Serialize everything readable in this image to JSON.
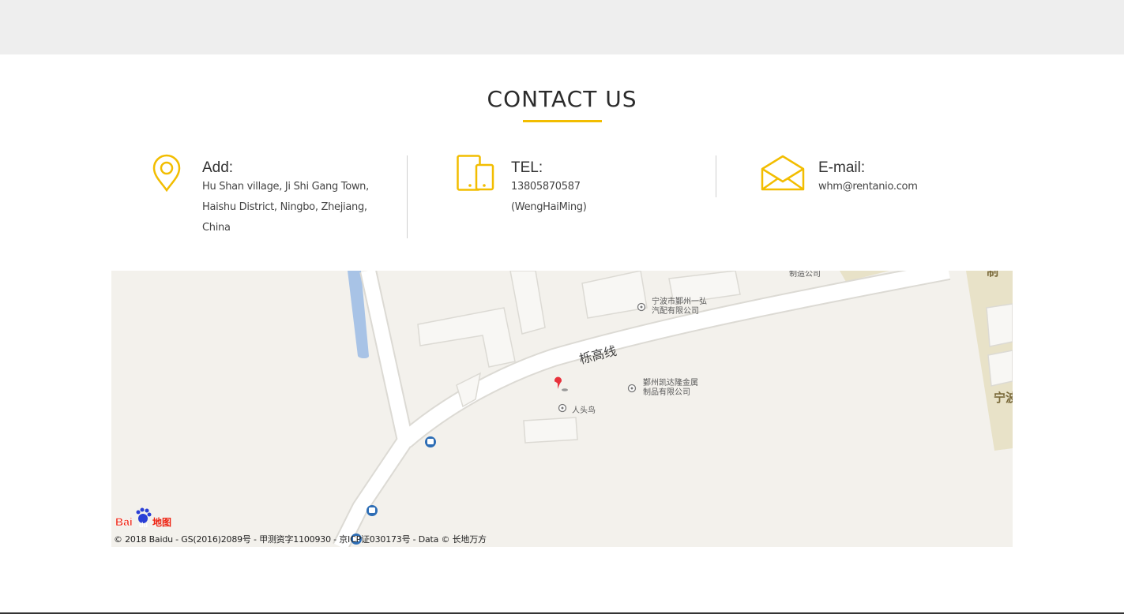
{
  "section": {
    "title": "CONTACT US"
  },
  "contacts": [
    {
      "icon": "location-pin-icon",
      "heading": "Add:",
      "lines": [
        "Hu Shan village, Ji Shi Gang Town,",
        "Haishu District, Ningbo, Zhejiang,",
        "China"
      ]
    },
    {
      "icon": "mobile-phone-icon",
      "heading": "TEL:",
      "lines": [
        "13805870587 (WengHaiMing)"
      ]
    },
    {
      "icon": "envelope-icon",
      "heading": "E-mail:",
      "lines": [
        "whm@rentanio.com"
      ]
    }
  ],
  "colors": {
    "accent": "#f2bd00",
    "marker": "#e8323c",
    "bus_stop": "#2d6db5",
    "map_bg": "#f3f1ec",
    "water": "#a8c3e6"
  },
  "map": {
    "road_name": "栎高线",
    "pois": [
      {
        "name_line1": "宁波市鄞州一弘",
        "name_line2": "汽配有限公司"
      },
      {
        "name_line1": "鄞州凯达隆金属",
        "name_line2": "制品有限公司"
      },
      {
        "name_line1": "人头鸟",
        "name_line2": ""
      },
      {
        "name_line1": "制造公司",
        "name_line2": ""
      }
    ],
    "edge_labels": [
      "制",
      "宁波"
    ],
    "logo_text": "Bai du 地图",
    "copyright": "© 2018 Baidu - GS(2016)2089号 - 甲测资字1100930 - 京ICP证030173号 - Data © 长地万方"
  }
}
